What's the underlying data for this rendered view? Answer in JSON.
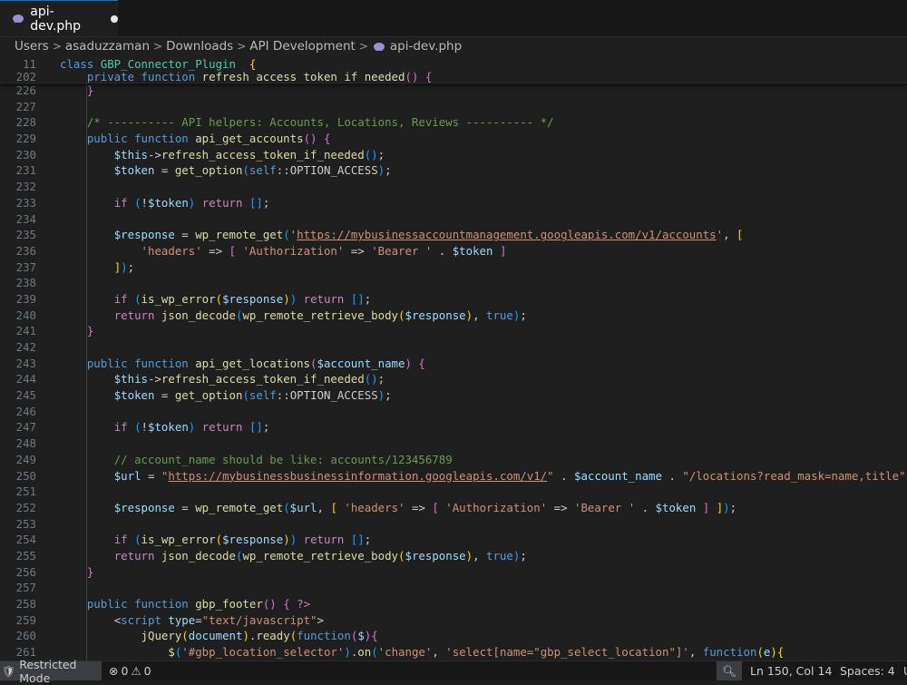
{
  "tab": {
    "label": "api-dev.php"
  },
  "breadcrumb": [
    "Users",
    "asaduzzaman",
    "Downloads",
    "API Development",
    "api-dev.php"
  ],
  "sticky": [
    {
      "num": "11",
      "tokens": [
        [
          "kw",
          "class "
        ],
        [
          "cls",
          "GBP_Connector_Plugin"
        ],
        [
          "",
          "  "
        ],
        [
          "br1",
          "{"
        ]
      ]
    },
    {
      "num": "202",
      "tokens": [
        [
          "",
          "    "
        ],
        [
          "kw",
          "private "
        ],
        [
          "kw",
          "function "
        ],
        [
          "fn",
          "refresh_access_token_if_needed"
        ],
        [
          "br2",
          "() {"
        ]
      ]
    }
  ],
  "lines": [
    {
      "num": "226",
      "tokens": [
        [
          "",
          "    "
        ],
        [
          "br2",
          "}"
        ]
      ]
    },
    {
      "num": "227",
      "tokens": []
    },
    {
      "num": "228",
      "tokens": [
        [
          "",
          "    "
        ],
        [
          "cm",
          "/* ---------- API helpers: Accounts, Locations, Reviews ---------- */"
        ]
      ]
    },
    {
      "num": "229",
      "tokens": [
        [
          "",
          "    "
        ],
        [
          "kw",
          "public "
        ],
        [
          "kw",
          "function "
        ],
        [
          "fn",
          "api_get_accounts"
        ],
        [
          "br2",
          "() {"
        ]
      ]
    },
    {
      "num": "230",
      "tokens": [
        [
          "",
          "        "
        ],
        [
          "var",
          "$this"
        ],
        [
          "",
          "->"
        ],
        [
          "fn",
          "refresh_access_token_if_needed"
        ],
        [
          "br3",
          "()"
        ],
        [
          ";",
          ";"
        ]
      ]
    },
    {
      "num": "231",
      "tokens": [
        [
          "",
          "        "
        ],
        [
          "var",
          "$token"
        ],
        [
          "",
          " = "
        ],
        [
          "fn",
          "get_option"
        ],
        [
          "br3",
          "("
        ],
        [
          "kw",
          "self"
        ],
        [
          "",
          "::"
        ],
        [
          "",
          "OPTION_ACCESS"
        ],
        [
          "br3",
          ")"
        ],
        [
          "",
          ";"
        ]
      ]
    },
    {
      "num": "232",
      "tokens": []
    },
    {
      "num": "233",
      "tokens": [
        [
          "",
          "        "
        ],
        [
          "ctl",
          "if "
        ],
        [
          "br3",
          "("
        ],
        [
          "",
          "!"
        ],
        [
          "var",
          "$token"
        ],
        [
          "br3",
          ")"
        ],
        [
          "",
          " "
        ],
        [
          "ctl",
          "return "
        ],
        [
          "br3",
          "[]"
        ],
        [
          "",
          ";"
        ]
      ]
    },
    {
      "num": "234",
      "tokens": []
    },
    {
      "num": "235",
      "tokens": [
        [
          "",
          "        "
        ],
        [
          "var",
          "$response"
        ],
        [
          "",
          " = "
        ],
        [
          "fn",
          "wp_remote_get"
        ],
        [
          "br3",
          "("
        ],
        [
          "str",
          "'"
        ],
        [
          "url",
          "https://mybusinessaccountmanagement.googleapis.com/v1/accounts"
        ],
        [
          "str",
          "'"
        ],
        [
          "",
          ", "
        ],
        [
          "br1",
          "["
        ]
      ]
    },
    {
      "num": "236",
      "tokens": [
        [
          "",
          "            "
        ],
        [
          "str",
          "'headers'"
        ],
        [
          "",
          " => "
        ],
        [
          "br2",
          "[ "
        ],
        [
          "str",
          "'Authorization'"
        ],
        [
          "",
          " => "
        ],
        [
          "str",
          "'Bearer '"
        ],
        [
          "",
          " . "
        ],
        [
          "var",
          "$token"
        ],
        [
          "br2",
          " ]"
        ]
      ]
    },
    {
      "num": "237",
      "tokens": [
        [
          "",
          "        "
        ],
        [
          "br1",
          "]"
        ],
        [
          "br3",
          ")"
        ],
        [
          "",
          ";"
        ]
      ]
    },
    {
      "num": "238",
      "tokens": []
    },
    {
      "num": "239",
      "tokens": [
        [
          "",
          "        "
        ],
        [
          "ctl",
          "if "
        ],
        [
          "br3",
          "("
        ],
        [
          "fn",
          "is_wp_error"
        ],
        [
          "br1",
          "("
        ],
        [
          "var",
          "$response"
        ],
        [
          "br1",
          ")"
        ],
        [
          "br3",
          ")"
        ],
        [
          "",
          " "
        ],
        [
          "ctl",
          "return "
        ],
        [
          "br3",
          "[]"
        ],
        [
          "",
          ";"
        ]
      ]
    },
    {
      "num": "240",
      "tokens": [
        [
          "",
          "        "
        ],
        [
          "ctl",
          "return "
        ],
        [
          "fn",
          "json_decode"
        ],
        [
          "br3",
          "("
        ],
        [
          "fn",
          "wp_remote_retrieve_body"
        ],
        [
          "br1",
          "("
        ],
        [
          "var",
          "$response"
        ],
        [
          "br1",
          ")"
        ],
        [
          "",
          ", "
        ],
        [
          "kw",
          "true"
        ],
        [
          "br3",
          ")"
        ],
        [
          "",
          ";"
        ]
      ]
    },
    {
      "num": "241",
      "tokens": [
        [
          "",
          "    "
        ],
        [
          "br2",
          "}"
        ]
      ]
    },
    {
      "num": "242",
      "tokens": []
    },
    {
      "num": "243",
      "tokens": [
        [
          "",
          "    "
        ],
        [
          "kw",
          "public "
        ],
        [
          "kw",
          "function "
        ],
        [
          "fn",
          "api_get_locations"
        ],
        [
          "br2",
          "("
        ],
        [
          "var",
          "$account_name"
        ],
        [
          "br2",
          ") {"
        ]
      ]
    },
    {
      "num": "244",
      "tokens": [
        [
          "",
          "        "
        ],
        [
          "var",
          "$this"
        ],
        [
          "",
          "->"
        ],
        [
          "fn",
          "refresh_access_token_if_needed"
        ],
        [
          "br3",
          "()"
        ],
        [
          "",
          ";"
        ]
      ]
    },
    {
      "num": "245",
      "tokens": [
        [
          "",
          "        "
        ],
        [
          "var",
          "$token"
        ],
        [
          "",
          " = "
        ],
        [
          "fn",
          "get_option"
        ],
        [
          "br3",
          "("
        ],
        [
          "kw",
          "self"
        ],
        [
          "",
          "::"
        ],
        [
          "",
          "OPTION_ACCESS"
        ],
        [
          "br3",
          ")"
        ],
        [
          "",
          ";"
        ]
      ]
    },
    {
      "num": "246",
      "tokens": []
    },
    {
      "num": "247",
      "tokens": [
        [
          "",
          "        "
        ],
        [
          "ctl",
          "if "
        ],
        [
          "br3",
          "("
        ],
        [
          "",
          "!"
        ],
        [
          "var",
          "$token"
        ],
        [
          "br3",
          ")"
        ],
        [
          "",
          " "
        ],
        [
          "ctl",
          "return "
        ],
        [
          "br3",
          "[]"
        ],
        [
          "",
          ";"
        ]
      ]
    },
    {
      "num": "248",
      "tokens": []
    },
    {
      "num": "249",
      "tokens": [
        [
          "",
          "        "
        ],
        [
          "cm",
          "// account_name should be like: accounts/123456789"
        ]
      ]
    },
    {
      "num": "250",
      "tokens": [
        [
          "",
          "        "
        ],
        [
          "var",
          "$url"
        ],
        [
          "",
          " = "
        ],
        [
          "str",
          "\""
        ],
        [
          "url",
          "https://mybusinessbusinessinformation.googleapis.com/v1/"
        ],
        [
          "str",
          "\""
        ],
        [
          "",
          " . "
        ],
        [
          "var",
          "$account_name"
        ],
        [
          "",
          " . "
        ],
        [
          "str",
          "\"/locations?read_mask=name,title\""
        ],
        [
          "",
          ";"
        ]
      ]
    },
    {
      "num": "251",
      "tokens": []
    },
    {
      "num": "252",
      "tokens": [
        [
          "",
          "        "
        ],
        [
          "var",
          "$response"
        ],
        [
          "",
          " = "
        ],
        [
          "fn",
          "wp_remote_get"
        ],
        [
          "br3",
          "("
        ],
        [
          "var",
          "$url"
        ],
        [
          "",
          ", "
        ],
        [
          "br1",
          "[ "
        ],
        [
          "str",
          "'headers'"
        ],
        [
          "",
          " => "
        ],
        [
          "br2",
          "[ "
        ],
        [
          "str",
          "'Authorization'"
        ],
        [
          "",
          " => "
        ],
        [
          "str",
          "'Bearer '"
        ],
        [
          "",
          " . "
        ],
        [
          "var",
          "$token"
        ],
        [
          "br2",
          " ]"
        ],
        [
          "br1",
          " ]"
        ],
        [
          "br3",
          ")"
        ],
        [
          "",
          ";"
        ]
      ]
    },
    {
      "num": "253",
      "tokens": []
    },
    {
      "num": "254",
      "tokens": [
        [
          "",
          "        "
        ],
        [
          "ctl",
          "if "
        ],
        [
          "br3",
          "("
        ],
        [
          "fn",
          "is_wp_error"
        ],
        [
          "br1",
          "("
        ],
        [
          "var",
          "$response"
        ],
        [
          "br1",
          ")"
        ],
        [
          "br3",
          ")"
        ],
        [
          "",
          " "
        ],
        [
          "ctl",
          "return "
        ],
        [
          "br3",
          "[]"
        ],
        [
          "",
          ";"
        ]
      ]
    },
    {
      "num": "255",
      "tokens": [
        [
          "",
          "        "
        ],
        [
          "ctl",
          "return "
        ],
        [
          "fn",
          "json_decode"
        ],
        [
          "br3",
          "("
        ],
        [
          "fn",
          "wp_remote_retrieve_body"
        ],
        [
          "br1",
          "("
        ],
        [
          "var",
          "$response"
        ],
        [
          "br1",
          ")"
        ],
        [
          "",
          ", "
        ],
        [
          "kw",
          "true"
        ],
        [
          "br3",
          ")"
        ],
        [
          "",
          ";"
        ]
      ]
    },
    {
      "num": "256",
      "tokens": [
        [
          "",
          "    "
        ],
        [
          "br2",
          "}"
        ]
      ]
    },
    {
      "num": "257",
      "tokens": []
    },
    {
      "num": "258",
      "tokens": [
        [
          "",
          "    "
        ],
        [
          "kw",
          "public "
        ],
        [
          "kw",
          "function "
        ],
        [
          "fn",
          "gbp_footer"
        ],
        [
          "br2",
          "() { "
        ],
        [
          "ctl",
          "?>"
        ]
      ]
    },
    {
      "num": "259",
      "tokens": [
        [
          "",
          "        "
        ],
        [
          "",
          "<"
        ],
        [
          "tag",
          "script "
        ],
        [
          "attr",
          "type"
        ],
        [
          "",
          "="
        ],
        [
          "str",
          "\"text/javascript\""
        ],
        [
          "",
          ">"
        ]
      ]
    },
    {
      "num": "260",
      "tokens": [
        [
          "",
          "            "
        ],
        [
          "fn",
          "jQuery"
        ],
        [
          "br1",
          "("
        ],
        [
          "var",
          "document"
        ],
        [
          "br1",
          ")"
        ],
        [
          "",
          "."
        ],
        [
          "fn",
          "ready"
        ],
        [
          "br1",
          "("
        ],
        [
          "kw",
          "function"
        ],
        [
          "br2",
          "("
        ],
        [
          "var",
          "$"
        ],
        [
          "br2",
          ")"
        ],
        [
          "br2",
          "{"
        ]
      ]
    },
    {
      "num": "261",
      "tokens": [
        [
          "",
          "                "
        ],
        [
          "fn",
          "$"
        ],
        [
          "br3",
          "("
        ],
        [
          "str",
          "'#gbp_location_selector'"
        ],
        [
          "br3",
          ")"
        ],
        [
          "",
          "."
        ],
        [
          "fn",
          "on"
        ],
        [
          "br3",
          "("
        ],
        [
          "str",
          "'change'"
        ],
        [
          "",
          ", "
        ],
        [
          "str",
          "'select[name=\"gbp_select_location\"]'"
        ],
        [
          "",
          ", "
        ],
        [
          "kw",
          "function"
        ],
        [
          "br1",
          "("
        ],
        [
          "var",
          "e"
        ],
        [
          "br1",
          ")"
        ],
        [
          "br1",
          "{"
        ]
      ]
    }
  ],
  "statusbar": {
    "restricted": "Restricted Mode",
    "errors": "0",
    "warnings": "0",
    "position": "Ln 150, Col 14",
    "spaces": "Spaces: 4",
    "trailing": "U"
  }
}
